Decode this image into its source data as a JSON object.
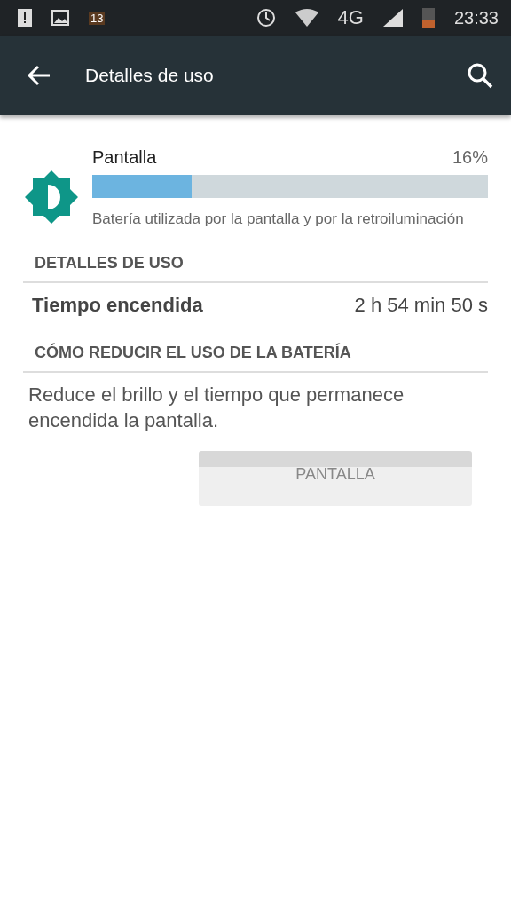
{
  "status_bar": {
    "notification_count": "13",
    "network": "4G",
    "time": "23:33"
  },
  "app_bar": {
    "title": "Detalles de uso"
  },
  "usage": {
    "name": "Pantalla",
    "percent": "16%",
    "level": 0.25,
    "description": "Batería utilizada por la pantalla y por la retroiluminación"
  },
  "sections": [
    {
      "header": "DETALLES DE USO",
      "rows": [
        {
          "label": "Tiempo encendida",
          "value": "2 h 54 min 50 s"
        }
      ]
    },
    {
      "header": "CÓMO REDUCIR EL USO DE LA BATERÍA",
      "text": "Reduce el brillo y el tiempo que permanece encendida la pantalla.",
      "button": "PANTALLA"
    }
  ]
}
